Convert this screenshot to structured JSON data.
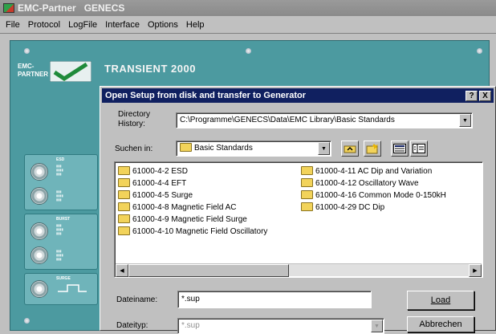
{
  "window": {
    "app_name": "EMC-Partner",
    "title": "GENECS"
  },
  "menu": [
    {
      "label": "File"
    },
    {
      "label": "Protocol"
    },
    {
      "label": "LogFile"
    },
    {
      "label": "Interface"
    },
    {
      "label": "Options"
    },
    {
      "label": "Help"
    }
  ],
  "device": {
    "logo_text": "EMC-\nPARTNER",
    "brand": "TRANSIENT 2000",
    "colors": {
      "panel": "#4c9aa0",
      "dialog_title": "#102060"
    },
    "modules": [
      {
        "label": "ESD",
        "knobs": 2
      },
      {
        "label": "BURST",
        "knobs": 2
      },
      {
        "label": "SURGE",
        "knobs": 1
      }
    ]
  },
  "dialog": {
    "title": "Open Setup from disk and transfer to Generator",
    "help_btn": "?",
    "close_btn": "X",
    "directory_history_label": "Directory History:",
    "directory_history_value": "C:\\Programme\\GENECS\\Data\\EMC Library\\Basic Standards",
    "search_in_label": "Suchen in:",
    "search_in_value": "Basic Standards",
    "files_col1": [
      "61000-4-2  ESD",
      "61000-4-4  EFT",
      "61000-4-5  Surge",
      "61000-4-8  Magnetic Field AC",
      "61000-4-9  Magnetic Field Surge",
      "61000-4-10  Magnetic Field Oscillatory"
    ],
    "files_col2": [
      "61000-4-11  AC Dip and Variation",
      "61000-4-12  Oscillatory Wave",
      "61000-4-16  Common Mode 0-150kH",
      "61000-4-29  DC Dip"
    ],
    "filename_label": "Dateiname:",
    "filename_value": "*.sup",
    "filetype_label": "Dateityp:",
    "filetype_value": "*.sup",
    "load_button": "Load",
    "cancel_button": "Abbrechen"
  }
}
